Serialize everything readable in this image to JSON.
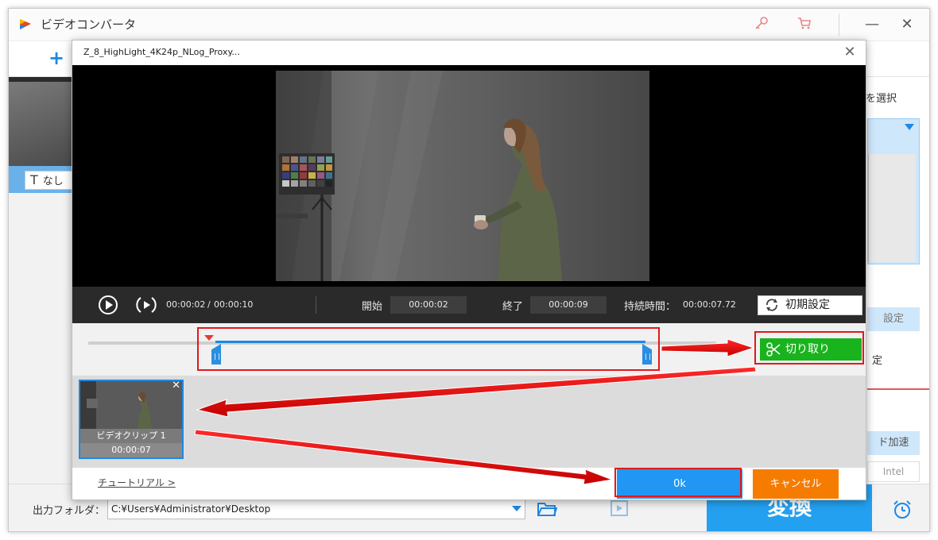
{
  "app": {
    "title": "ビデオコンバータ",
    "key_icon": "key-icon",
    "cart_icon": "cart-icon"
  },
  "window_controls": {
    "minimize": "—",
    "close": "✕"
  },
  "main": {
    "add_button_icon": "+",
    "subtitle_selector": "なし",
    "right_panel": {
      "format_label_partial": "を選択",
      "settings_partial": "設定",
      "setting_partial2": "定",
      "hw_accel_partial": "ド加速",
      "intel_label": "Intel"
    },
    "output_folder_label": "出力フォルダ：",
    "output_folder_path": "C:¥Users¥Administrator¥Desktop",
    "convert_button": "変換"
  },
  "dialog": {
    "title": "Z_8_HighLight_4K24p_NLog_Proxy...",
    "close": "✕",
    "controls": {
      "current_time": "00:00:02",
      "total_time": "00:00:10",
      "time_separator": "/",
      "start_label": "開始",
      "start_value": "00:00:02",
      "end_label": "終了",
      "end_value": "00:00:09",
      "duration_label": "持続時間：",
      "duration_value": "00:00:07.72",
      "reset_button": "初期設定"
    },
    "trim": {
      "cut_button": "切り取り",
      "selection_start_fraction": 0.2,
      "selection_end_fraction": 0.9
    },
    "clips": [
      {
        "name": "ビデオクリップ 1",
        "duration": "00:00:07"
      }
    ],
    "footer": {
      "tutorial_link": "チュートリアル >",
      "ok_button": "0k",
      "cancel_button": "キャンセル"
    }
  },
  "colors": {
    "accent_blue": "#2196f3",
    "cut_green": "#19b31e",
    "cancel_orange": "#f57c00",
    "annotation_red": "#e0191b"
  }
}
